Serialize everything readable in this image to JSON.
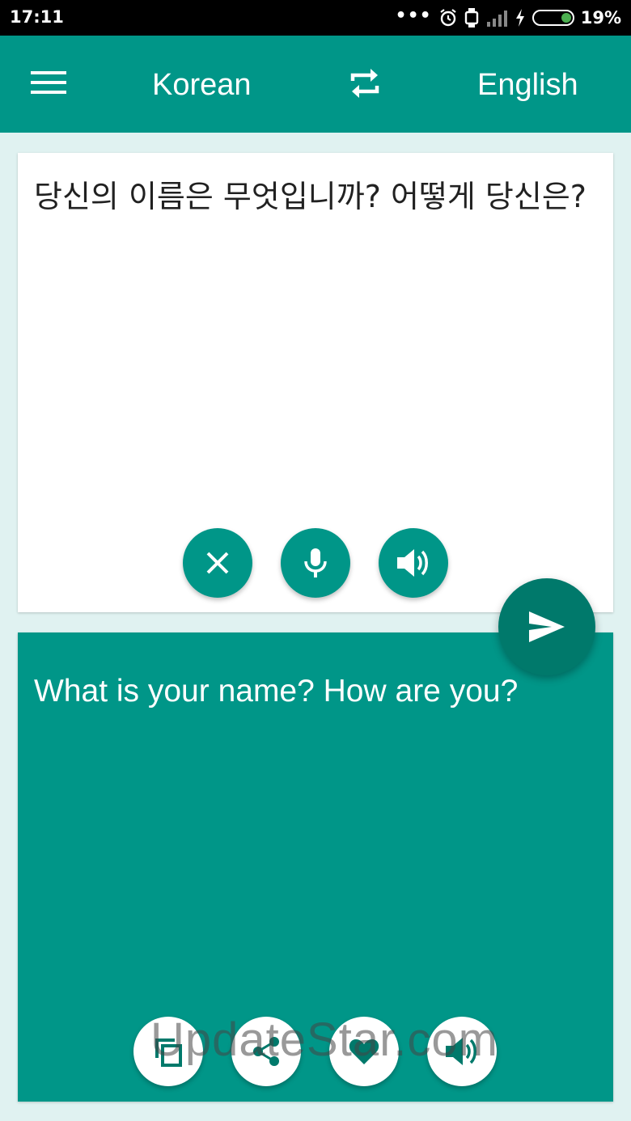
{
  "status_bar": {
    "time": "17:11",
    "battery_percent": "19%",
    "dots": "•••"
  },
  "app_bar": {
    "source_language": "Korean",
    "target_language": "English"
  },
  "source": {
    "text": "당신의 이름은 무엇입니까? 어떻게 당신은?"
  },
  "target": {
    "text": "What is your name? How are you?"
  },
  "watermark": "UpdateStar.com",
  "colors": {
    "primary": "#009688",
    "primary_dark": "#00796b",
    "background": "#e0f2f1"
  },
  "icons": {
    "menu": "menu-icon",
    "swap": "swap-icon",
    "clear": "close-icon",
    "mic": "microphone-icon",
    "speak_source": "speaker-icon",
    "translate": "send-icon",
    "copy": "copy-icon",
    "share": "share-icon",
    "favorite": "heart-icon",
    "speak_target": "speaker-icon"
  }
}
